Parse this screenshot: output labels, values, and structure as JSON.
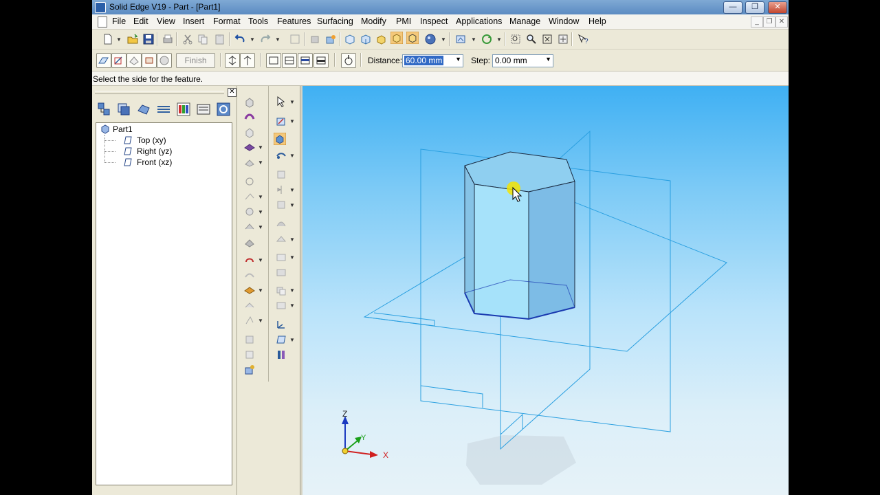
{
  "window": {
    "title": "Solid Edge V19 - Part - [Part1]",
    "controls": [
      "—",
      "❐",
      "✕"
    ]
  },
  "menu": {
    "items": [
      "File",
      "Edit",
      "View",
      "Insert",
      "Format",
      "Tools",
      "Features",
      "Surfacing",
      "Modify",
      "PMI",
      "Inspect",
      "Applications",
      "Manage",
      "Window",
      "Help"
    ]
  },
  "ribbon": {
    "finish_label": "Finish",
    "distance_label": "Distance:",
    "distance_value": "60.00 mm",
    "step_label": "Step:",
    "step_value": "0.00 mm"
  },
  "prompt": {
    "text": "Select the side for the feature."
  },
  "pathfinder": {
    "root": "Part1",
    "nodes": [
      "Top (xy)",
      "Right (yz)",
      "Front (xz)"
    ]
  },
  "triad": {
    "z": "Z",
    "y": "Y",
    "x": "X"
  },
  "colors": {
    "viewport_top": "#3fb0f3",
    "viewport_bottom": "#e6f2f8",
    "plane_edge": "#2a9fe0",
    "highlight": "#316ac5"
  }
}
